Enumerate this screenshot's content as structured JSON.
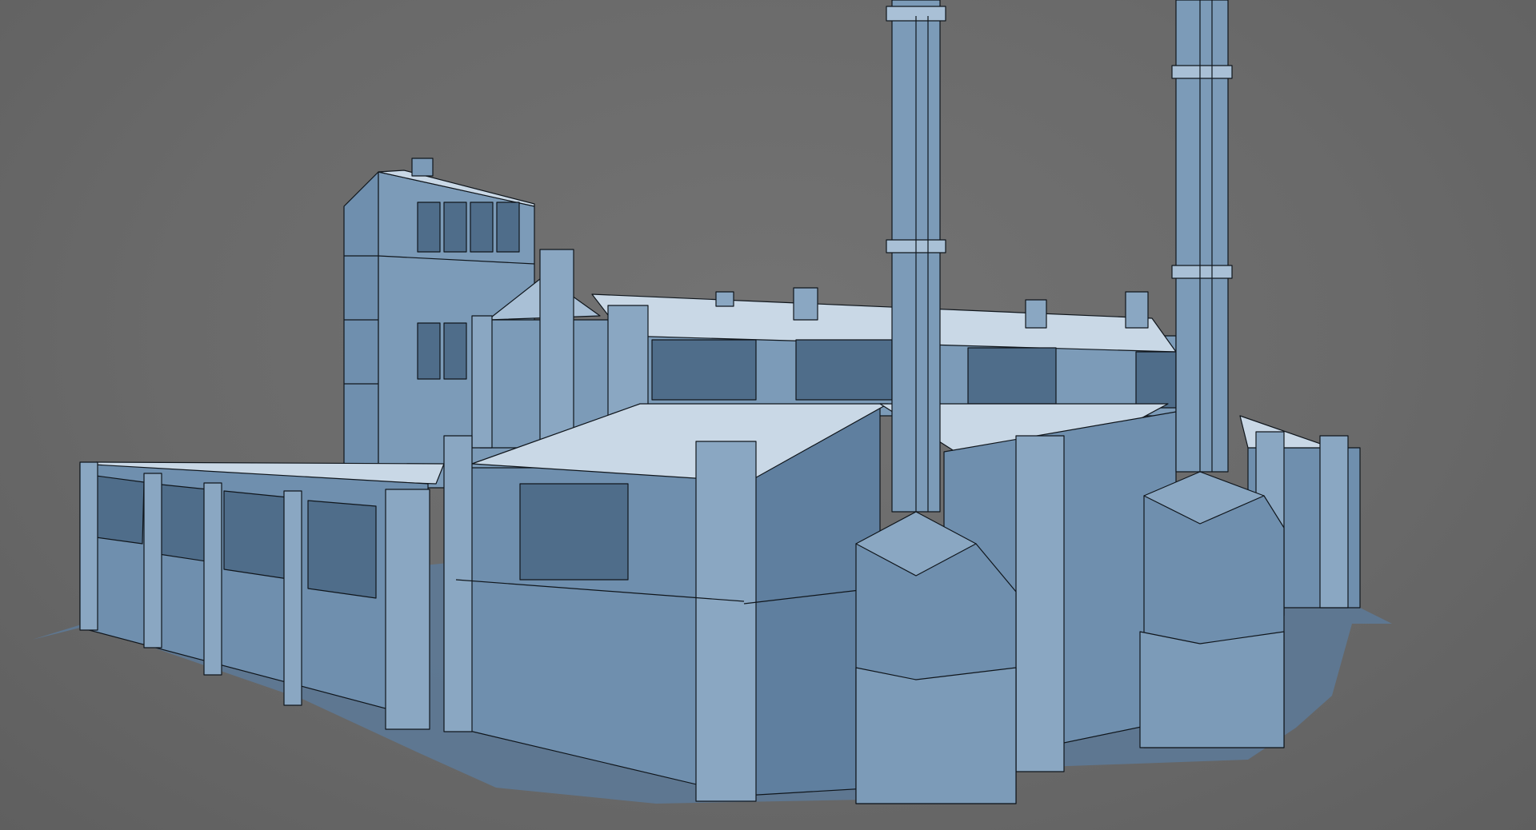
{
  "viewport": {
    "background": "#6d6d6d",
    "model_colors": {
      "base": "#6f8fae",
      "light": "#a9c0d6",
      "roof": "#c9d8e6",
      "dark": "#4f6d8a",
      "edge": "#10161c",
      "shadow": "#5d7a99"
    }
  },
  "scene": {
    "subject": "3d-model-industrial-boiler-house",
    "chimney_count": 2,
    "render_mode": "solid-with-wireframe"
  }
}
